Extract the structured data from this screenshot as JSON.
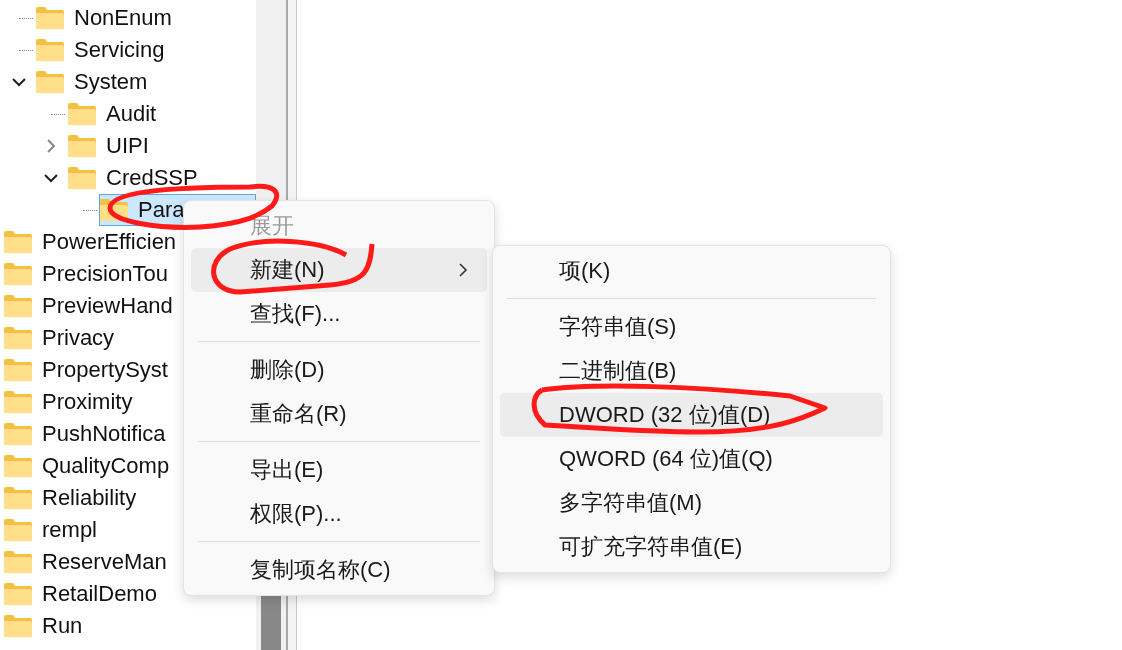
{
  "tree": {
    "upper_items": [
      {
        "label": "NonEnum",
        "selected": false
      },
      {
        "label": "Servicing",
        "selected": false
      },
      {
        "label": "System",
        "selected": false,
        "expanded": true,
        "children": [
          {
            "label": "Audit",
            "selected": false
          },
          {
            "label": "UIPI",
            "selected": false,
            "expanded": false
          },
          {
            "label": "CredSSP",
            "selected": false,
            "expanded": true,
            "children": [
              {
                "label": "Para",
                "selected": true
              }
            ]
          }
        ]
      }
    ],
    "items": [
      {
        "label": "PowerEfficien",
        "selected": false
      },
      {
        "label": "PrecisionTou",
        "selected": false
      },
      {
        "label": "PreviewHand",
        "selected": false
      },
      {
        "label": "Privacy",
        "selected": false
      },
      {
        "label": "PropertySyst",
        "selected": false
      },
      {
        "label": "Proximity",
        "selected": false
      },
      {
        "label": "PushNotifica",
        "selected": false
      },
      {
        "label": "QualityComp",
        "selected": false
      },
      {
        "label": "Reliability",
        "selected": false
      },
      {
        "label": "rempl",
        "selected": false
      },
      {
        "label": "ReserveMan",
        "selected": false
      },
      {
        "label": "RetailDemo",
        "selected": false
      },
      {
        "label": "Run",
        "selected": false
      }
    ]
  },
  "context_menu": {
    "groups": [
      [
        {
          "label": "展开",
          "disabled": true,
          "highlighted": false,
          "submenu": false
        },
        {
          "label": "新建(N)",
          "disabled": false,
          "highlighted": true,
          "submenu": true
        },
        {
          "label": "查找(F)...",
          "disabled": false,
          "highlighted": false,
          "submenu": false
        }
      ],
      [
        {
          "label": "删除(D)",
          "disabled": false,
          "highlighted": false,
          "submenu": false
        },
        {
          "label": "重命名(R)",
          "disabled": false,
          "highlighted": false,
          "submenu": false
        }
      ],
      [
        {
          "label": "导出(E)",
          "disabled": false,
          "highlighted": false,
          "submenu": false
        },
        {
          "label": "权限(P)...",
          "disabled": false,
          "highlighted": false,
          "submenu": false
        }
      ],
      [
        {
          "label": "复制项名称(C)",
          "disabled": false,
          "highlighted": false,
          "submenu": false
        }
      ]
    ]
  },
  "submenu": {
    "groups": [
      [
        {
          "label": "项(K)",
          "disabled": false,
          "highlighted": false,
          "submenu": false
        }
      ],
      [
        {
          "label": "字符串值(S)",
          "disabled": false,
          "highlighted": false,
          "submenu": false
        },
        {
          "label": "二进制值(B)",
          "disabled": false,
          "highlighted": false,
          "submenu": false
        },
        {
          "label": "DWORD (32 位)值(D)",
          "disabled": false,
          "highlighted": true,
          "submenu": false
        },
        {
          "label": "QWORD (64 位)值(Q)",
          "disabled": false,
          "highlighted": false,
          "submenu": false
        },
        {
          "label": "多字符串值(M)",
          "disabled": false,
          "highlighted": false,
          "submenu": false
        },
        {
          "label": "可扩充字符串值(E)",
          "disabled": false,
          "highlighted": false,
          "submenu": false
        }
      ]
    ]
  }
}
